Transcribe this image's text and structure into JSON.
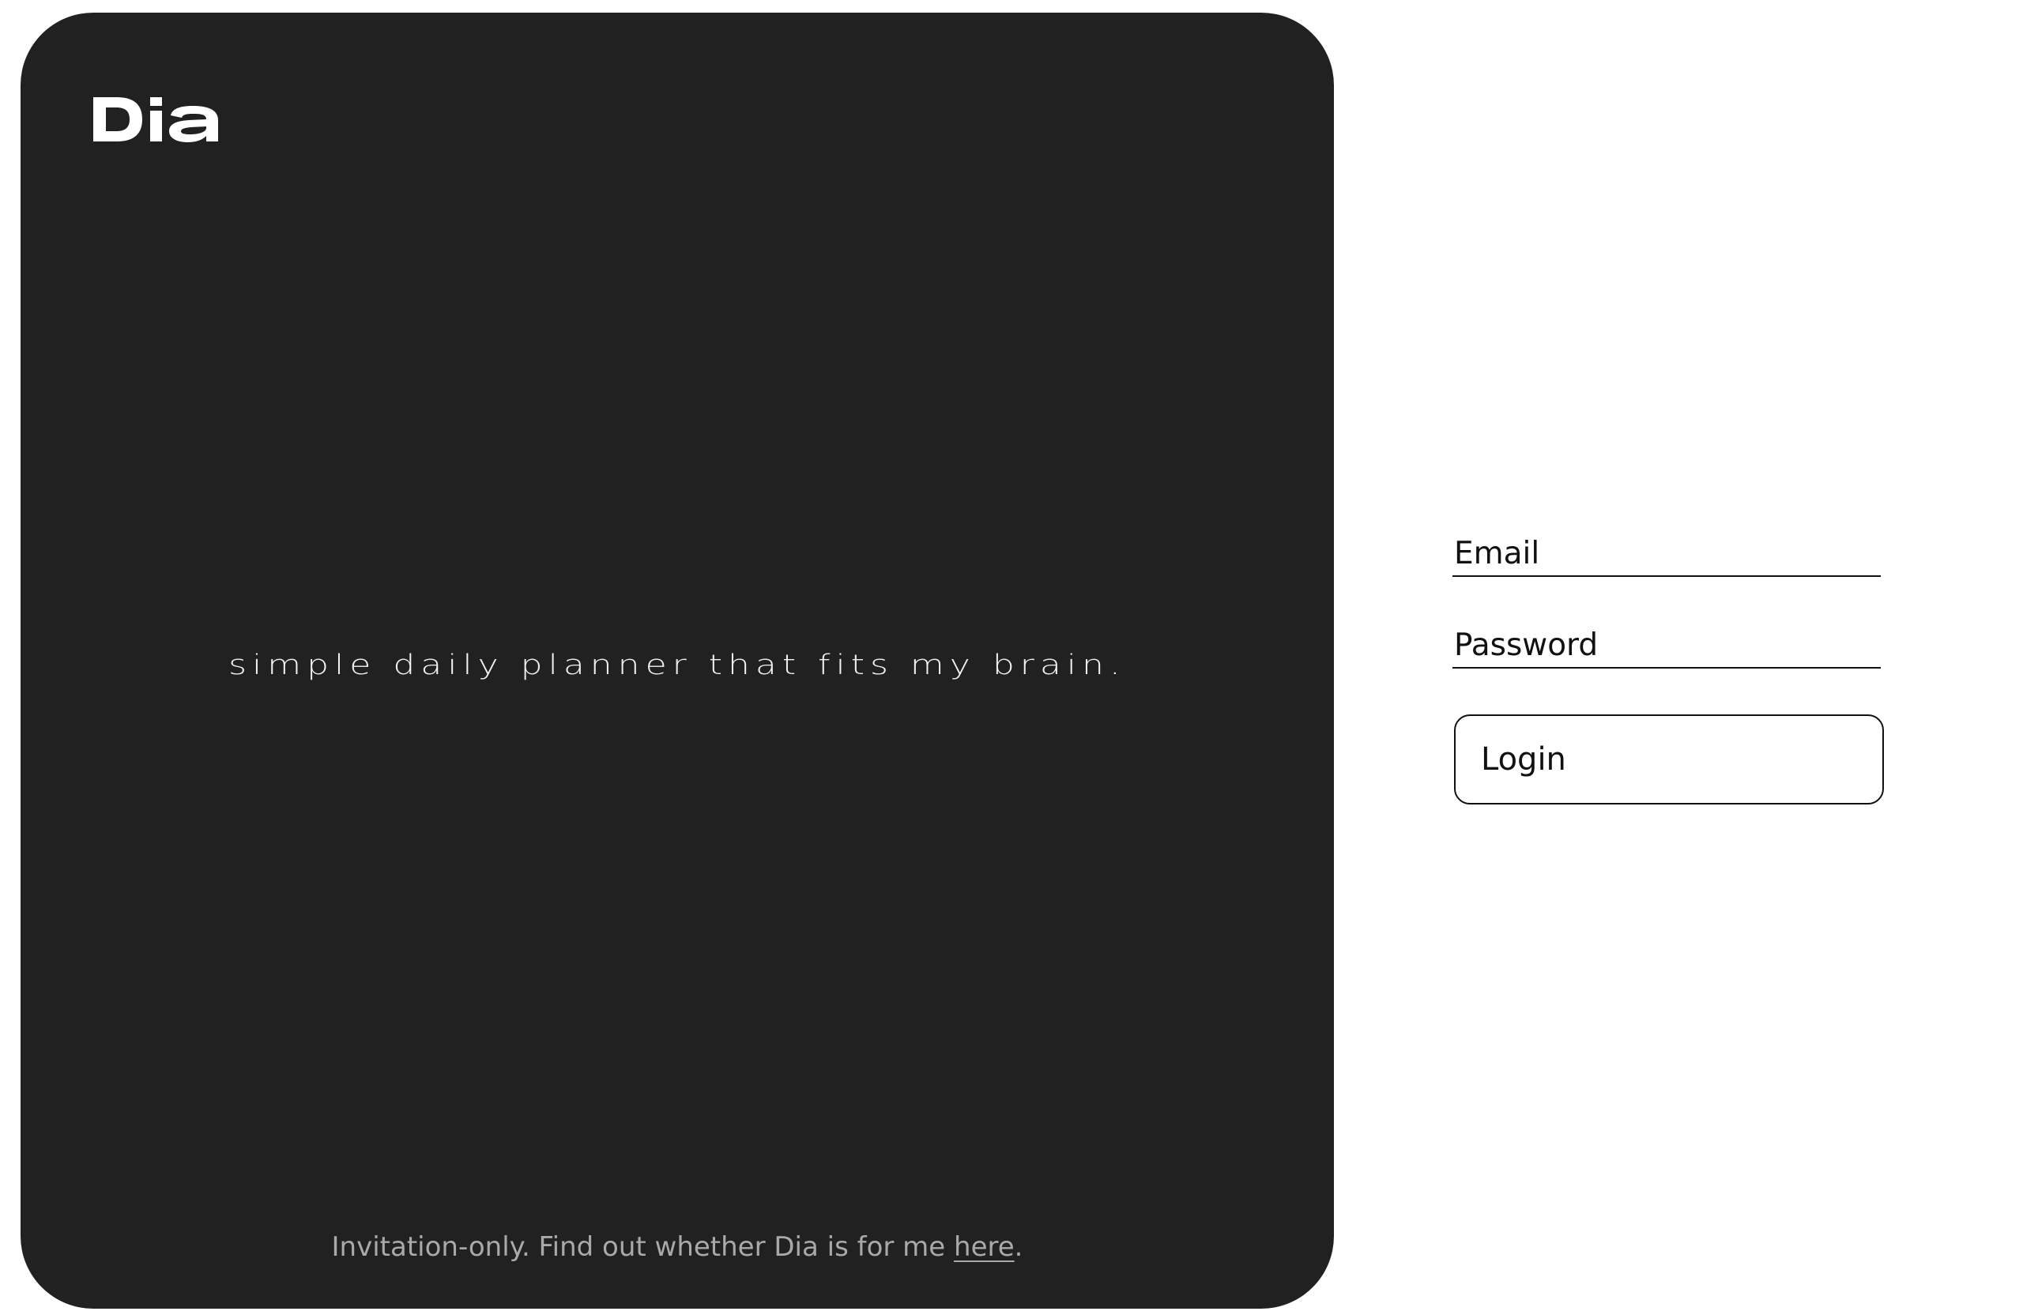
{
  "hero": {
    "logo_text": "Dia",
    "tagline": "simple daily planner that fits my brain.",
    "footer_text": "Invitation-only. Find out whether Dia is for me ",
    "footer_link": "here",
    "footer_end": "."
  },
  "form": {
    "email_placeholder": "Email",
    "password_placeholder": "Password",
    "login_label": "Login"
  },
  "colors": {
    "hero_background": "#212121",
    "page_background": "#ffffff",
    "tagline": "#f2f2f2",
    "footer_text": "#a9a9a9"
  }
}
